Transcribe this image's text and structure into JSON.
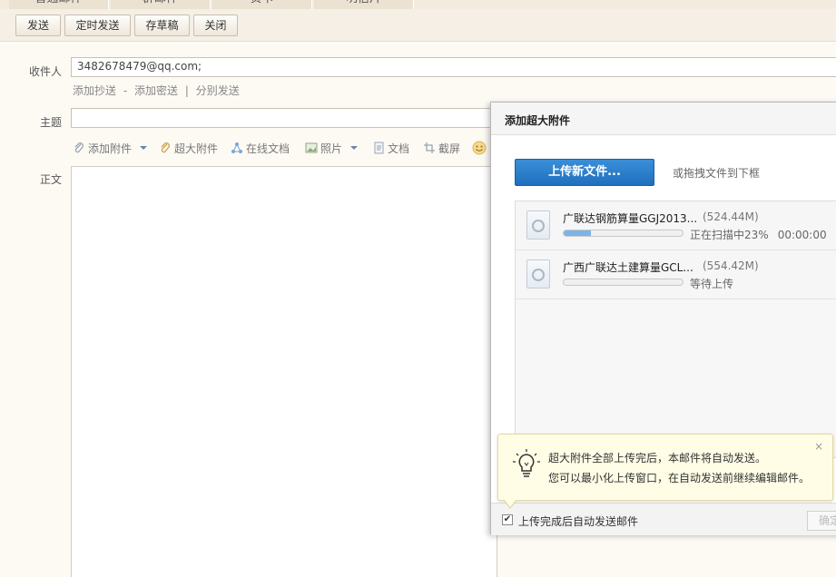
{
  "tabs": [
    "普通邮件",
    "群邮件",
    "贺卡",
    "明信片"
  ],
  "toolbar": {
    "send": "发送",
    "schedule": "定时发送",
    "draft": "存草稿",
    "close": "关闭"
  },
  "compose": {
    "to_label": "收件人",
    "to_value": "3482678479@qq.com;",
    "add_cc": "添加抄送",
    "add_bcc": "添加密送",
    "separate_send": "分别发送",
    "dash": "-",
    "pipe": "|",
    "subject_label": "主题",
    "body_label": "正文",
    "attach": {
      "add_attachment": "添加附件",
      "large_attachment": "超大附件",
      "online_doc": "在线文档",
      "photo": "照片",
      "document": "文档",
      "screenshot": "截屏"
    }
  },
  "dialog": {
    "title": "添加超大附件",
    "upload_button": "上传新文件...",
    "drag_hint": "或拖拽文件到下框",
    "files": [
      {
        "name": "广联达钢筋算量GGJ2013...",
        "size": "(524.44M)",
        "status": "正在扫描中23%",
        "time": "00:00:00",
        "progress": 0.23
      },
      {
        "name": "广西广联达土建算量GCL...",
        "size": "(554.42M)",
        "status": "等待上传",
        "time": "",
        "progress": 0
      }
    ],
    "tip": {
      "line1": "超大附件全部上传完后，本邮件将自动发送。",
      "line2": "您可以最小化上传窗口，在自动发送前继续编辑邮件。",
      "close": "×"
    },
    "auto_send_label": "上传完成后自动发送邮件",
    "auto_send_checked": "✔",
    "footer_button": "确定"
  },
  "colors": {
    "accent_blue": "#1f6fbe",
    "page_bg": "#fdfaf4",
    "toolbar_bg": "#f5efe6"
  }
}
